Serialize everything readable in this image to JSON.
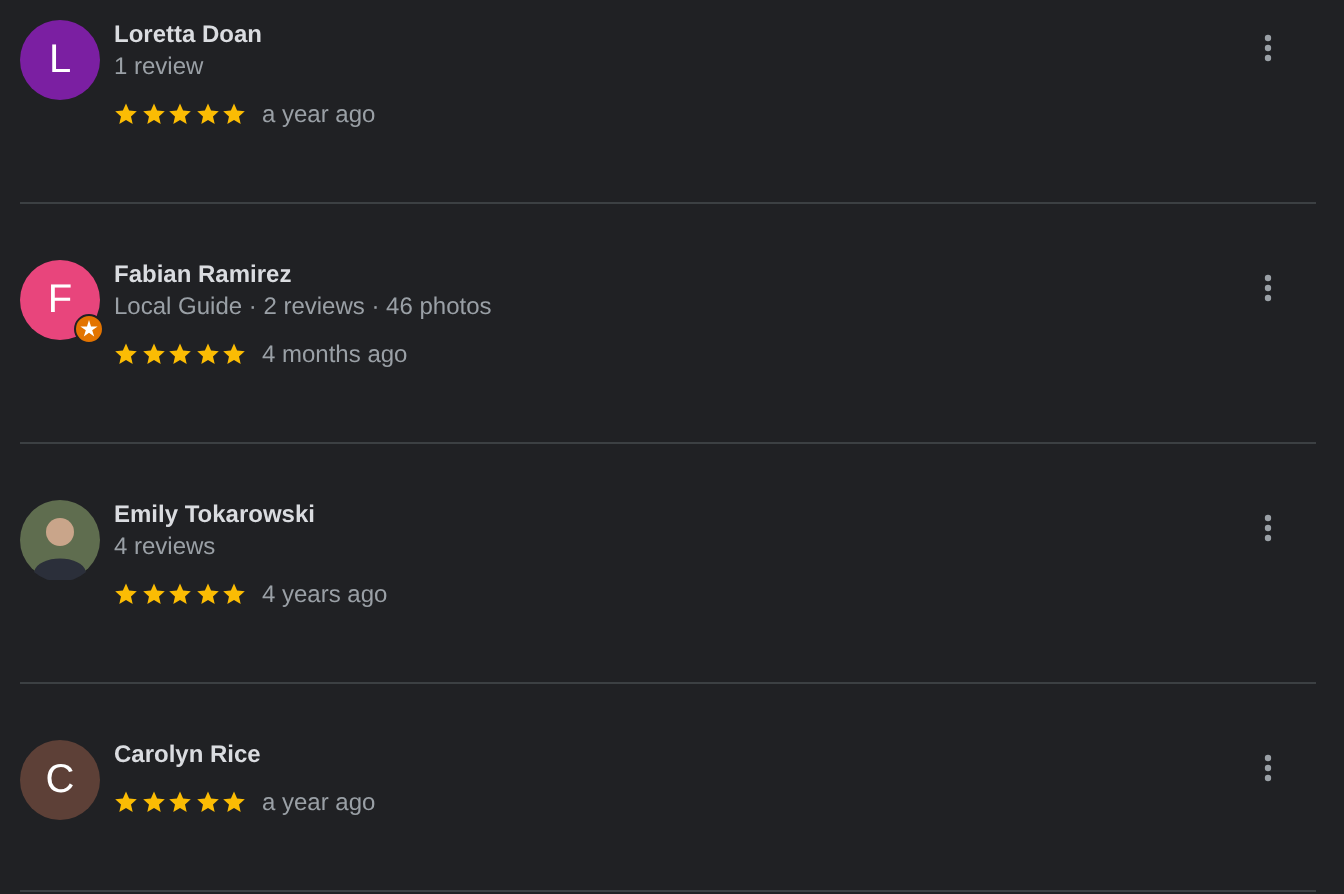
{
  "reviews": [
    {
      "avatar": {
        "kind": "letter",
        "letter": "L",
        "color": "#7b1fa2",
        "local_guide": false
      },
      "name": "Loretta Doan",
      "meta": "1 review",
      "stars": 5,
      "date": "a year ago"
    },
    {
      "avatar": {
        "kind": "letter",
        "letter": "F",
        "color": "#e8457c",
        "local_guide": true
      },
      "name": "Fabian Ramirez",
      "meta": "Local Guide · 2 reviews · 46 photos",
      "stars": 5,
      "date": "4 months ago"
    },
    {
      "avatar": {
        "kind": "photo",
        "local_guide": false
      },
      "name": "Emily Tokarowski",
      "meta": "4 reviews",
      "stars": 5,
      "date": "4 years ago"
    },
    {
      "avatar": {
        "kind": "letter",
        "letter": "C",
        "color": "#5d4037",
        "local_guide": false
      },
      "name": "Carolyn Rice",
      "stars": 5,
      "date": "a year ago"
    }
  ]
}
